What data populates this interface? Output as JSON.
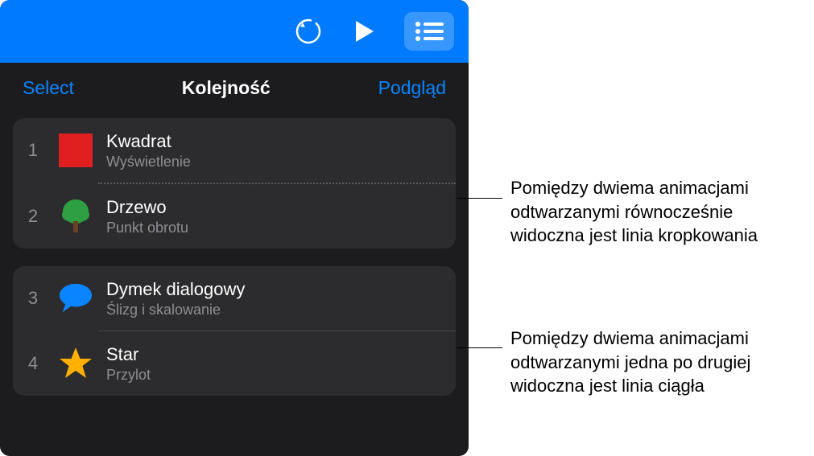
{
  "topbar": {
    "undo_icon": "undo",
    "play_icon": "play",
    "list_icon": "list"
  },
  "subheader": {
    "select": "Select",
    "title": "Kolejność",
    "preview": "Podgląd"
  },
  "groups": [
    {
      "items": [
        {
          "num": "1",
          "shape": "square",
          "title": "Kwadrat",
          "sub": "Wyświetlenie"
        },
        {
          "num": "2",
          "shape": "tree",
          "title": "Drzewo",
          "sub": "Punkt obrotu"
        }
      ],
      "separator": "dotted"
    },
    {
      "items": [
        {
          "num": "3",
          "shape": "bubble",
          "title": "Dymek dialogowy",
          "sub": "Ślizg i skalowanie"
        },
        {
          "num": "4",
          "shape": "star",
          "title": "Star",
          "sub": "Przylot"
        }
      ],
      "separator": "solid"
    }
  ],
  "callouts": {
    "c1": "Pomiędzy dwiema animacjami odtwarzanymi równocześnie widoczna jest linia kropkowania",
    "c2": "Pomiędzy dwiema animacjami odtwarzanymi jedna po drugiej widoczna jest linia ciągła"
  }
}
